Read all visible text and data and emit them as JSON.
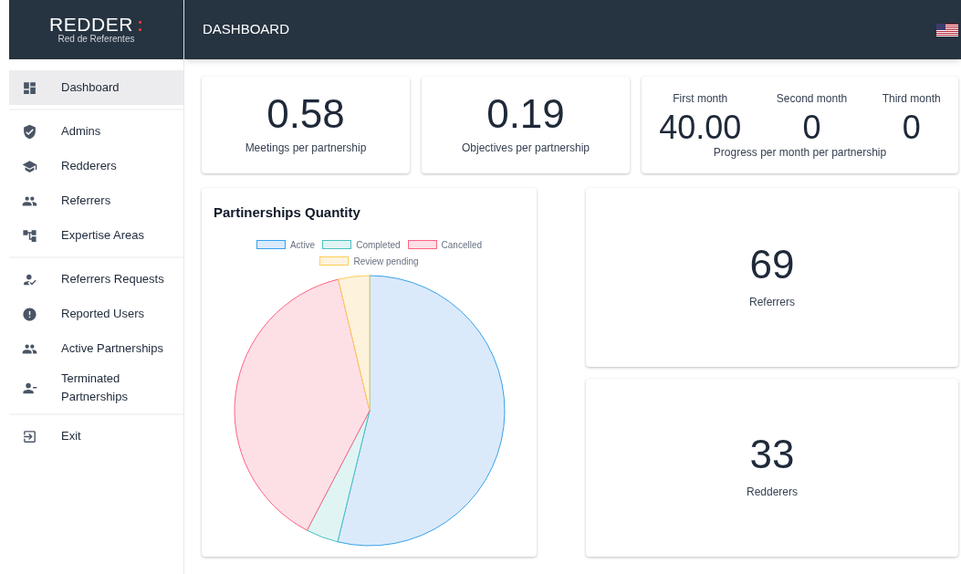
{
  "brand": {
    "name": "REDDER",
    "mark": ":",
    "tagline": "Red de Referentes"
  },
  "header": {
    "title": "DASHBOARD"
  },
  "sidebar": {
    "groups": [
      [
        {
          "label": "Dashboard",
          "selected": true
        }
      ],
      [
        {
          "label": "Admins",
          "selected": false
        },
        {
          "label": "Redderers",
          "selected": false
        },
        {
          "label": "Referrers",
          "selected": false
        },
        {
          "label": "Expertise Areas",
          "selected": false
        }
      ],
      [
        {
          "label": "Referrers Requests",
          "selected": false
        },
        {
          "label": "Reported Users",
          "selected": false
        },
        {
          "label": "Active Partnerships",
          "selected": false
        },
        {
          "label": "Terminated Partnerships",
          "selected": false
        }
      ],
      [
        {
          "label": "Exit",
          "selected": false
        }
      ]
    ]
  },
  "stats": [
    {
      "value": "0.58",
      "label": "Meetings per partnership"
    },
    {
      "value": "0.19",
      "label": "Objectives per partnership"
    }
  ],
  "progress": {
    "months": [
      {
        "label": "First month",
        "value": "40.00"
      },
      {
        "label": "Second month",
        "value": "0"
      },
      {
        "label": "Third month",
        "value": "0"
      }
    ],
    "caption": "Progress per month per partnership"
  },
  "chart": {
    "title": "Partinerships Quantity",
    "legend": [
      {
        "label": "Active",
        "color": "#36a2eb"
      },
      {
        "label": "Completed",
        "color": "#4bc0c0"
      },
      {
        "label": "Cancelled",
        "color": "#ff6384"
      },
      {
        "label": "Review pending",
        "color": "#ffcd56"
      }
    ]
  },
  "counts": [
    {
      "value": "69",
      "label": "Referrers"
    },
    {
      "value": "33",
      "label": "Redderers"
    }
  ]
}
